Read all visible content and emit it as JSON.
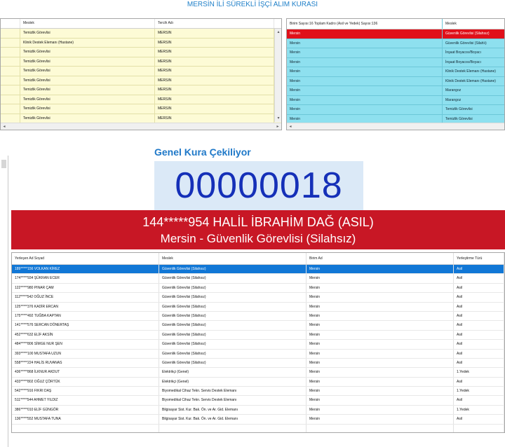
{
  "app": {
    "title": "MERSİN İLİ SÜREKLİ İŞÇİ ALIM KURASI"
  },
  "top_left_grid": {
    "columns": [
      "Meslek",
      "Tercih Adı"
    ],
    "rows": [
      [
        "Temizlik Görevlisi",
        "MERSIN"
      ],
      [
        "Klinik Destek Elemanı (Hastane)",
        "MERSIN"
      ],
      [
        "Temizlik Görevlisi",
        "MERSIN"
      ],
      [
        "Temizlik Görevlisi",
        "MERSIN"
      ],
      [
        "Temizlik Görevlisi",
        "MERSIN"
      ],
      [
        "Temizlik Görevlisi",
        "MERSIN"
      ],
      [
        "Temizlik Görevlisi",
        "MERSIN"
      ],
      [
        "Temizlik Görevlisi",
        "MERSIN"
      ],
      [
        "Temizlik Görevlisi",
        "MERSIN"
      ],
      [
        "Temizlik Görevlisi",
        "MERSIN"
      ]
    ]
  },
  "top_right_grid": {
    "header": "Birim Sayısı:16 Toplam Kadro (Asil ve Yedek) Sayısı:136",
    "column": "Meslek",
    "rows": [
      [
        "Mersin",
        "Güvenlik Görevlisi (Silahsız)"
      ],
      [
        "Mersin",
        "Güvenlik Görevlisi (Silahlı)"
      ],
      [
        "Mersin",
        "İnşaat Boyacısı/Boyacı"
      ],
      [
        "Mersin",
        "İnşaat Boyacısı/Boyacı"
      ],
      [
        "Mersin",
        "Klinik Destek Elemanı (Hastane)"
      ],
      [
        "Mersin",
        "Klinik Destek Elemanı (Hastane)"
      ],
      [
        "Mersin",
        "Marangoz"
      ],
      [
        "Mersin",
        "Marangoz"
      ],
      [
        "Mersin",
        "Temizlik Görevlisi"
      ],
      [
        "Mersin",
        "Temizlik Görevlisi"
      ]
    ]
  },
  "draw": {
    "heading": "Genel Kura Çekiliyor",
    "number": "00000018",
    "winner_line": "144*****954 HALİL İBRAHİM DAĞ (ASIL)",
    "placement_line": "Mersin - Güvenlik Görevlisi (Silahsız)"
  },
  "bottom_grid": {
    "columns": [
      "Yerleşen Ad Soyad",
      "Meslek",
      "Birim Ad",
      "Yerleştirme Türü"
    ],
    "rows": [
      [
        "189*****156 VOLKAN KİREZ",
        "Güvenlik Görevlisi (Silahsız)",
        "Mersin",
        "Asil"
      ],
      [
        "174*****934 ŞÜKRAN ECER",
        "Güvenlik Görevlisi (Silahsız)",
        "Mersin",
        "Asil"
      ],
      [
        "122*****980 PINAR ÇAM",
        "Güvenlik Görevlisi (Silahsız)",
        "Mersin",
        "Asil"
      ],
      [
        "112*****542 OĞUZ İNCE",
        "Güvenlik Görevlisi (Silahsız)",
        "Mersin",
        "Asil"
      ],
      [
        "125*****376 KADİR ERCAN",
        "Güvenlik Görevlisi (Silahsız)",
        "Mersin",
        "Asil"
      ],
      [
        "175*****492 TUĞBA KAPTAN",
        "Güvenlik Görevlisi (Silahsız)",
        "Mersin",
        "Asil"
      ],
      [
        "141*****576 SERCAN DÖNERTAŞ",
        "Güvenlik Görevlisi (Silahsız)",
        "Mersin",
        "Asil"
      ],
      [
        "452*****632 ELİF AKSİN",
        "Güvenlik Görevlisi (Silahsız)",
        "Mersin",
        "Asil"
      ],
      [
        "484*****806 SİMGE NUR ŞEN",
        "Güvenlik Görevlisi (Silahsız)",
        "Mersin",
        "Asil"
      ],
      [
        "393*****100 MUSTAFA UZUN",
        "Güvenlik Görevlisi (Silahsız)",
        "Mersin",
        "Asil"
      ],
      [
        "558*****224 HALİS RUVANAS",
        "Güvenlik Görevlisi (Silahsız)",
        "Mersin",
        "Asil"
      ],
      [
        "436*****868 İLKNUR AKDUT",
        "Elektrikçi (Genel)",
        "Mersin",
        "1.Yedek"
      ],
      [
        "433*****802 OĞUZ ÇÖRTÜK",
        "Elektrikçi (Genel)",
        "Mersin",
        "Asil"
      ],
      [
        "542*****916 FIKRI DAŞ",
        "Biyomedikal Cihaz Tekn. Servis Destek Elemanı",
        "Mersin",
        "1.Yedek"
      ],
      [
        "511*****544 AHMET YILDIZ",
        "Biyomedikal Cihaz Tekn. Servis Destek Elemanı",
        "Mersin",
        "Asil"
      ],
      [
        "386*****010 ELİF GÜNGÖR",
        "Bilgisayar Sist. Kur. Bak. Ön. ve Ar. Gid. Elemanı",
        "Mersin",
        "1.Yedek"
      ],
      [
        "136*****552 MUSTAFA TUNA",
        "Bilgisayar Sist. Kur. Bak. Ön. ve Ar. Gid. Elemanı",
        "Mersin",
        "Asil"
      ]
    ]
  },
  "icons": {
    "scroll_left": "◂",
    "scroll_right": "▸",
    "scroll_up": "▴",
    "scroll_down": "▾"
  },
  "colors": {
    "accent": "#1e78c8",
    "banner": "#c81725",
    "selected_row_blue": "#1177d6",
    "selected_row_red": "#e0101a",
    "yellow_grid": "#fdfbd6",
    "cyan_grid": "#8ee0ef",
    "counter_text": "#1530b8"
  }
}
